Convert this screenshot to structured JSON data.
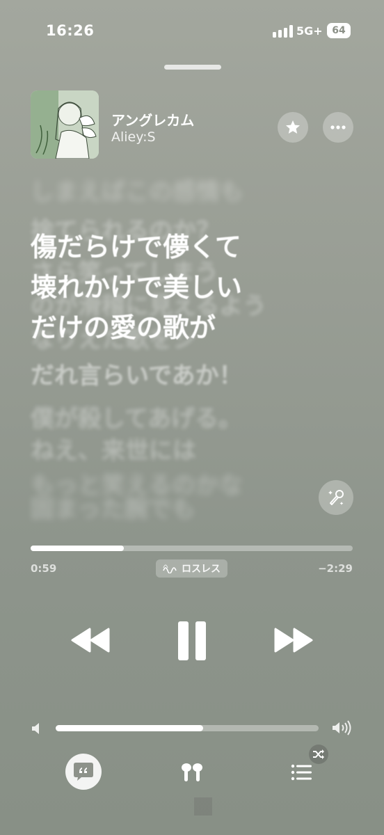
{
  "status_bar": {
    "time": "16:26",
    "network": "5G+",
    "battery": "64"
  },
  "now_playing": {
    "title": "アングレカム",
    "artist": "Aliey:S",
    "favorite_icon": "star-icon",
    "more_icon": "ellipsis-icon"
  },
  "lyrics": {
    "upcoming_top_blurred": [
      "しまえばこの感情も",
      "捨てられるのか？",
      "さら笑ってしまう",
      "のが滑稽に見えるよう",
      "なりえた歌をシ"
    ],
    "active_lines": [
      "傷だらけで儚くて",
      "壊れかけで美しい",
      "だけの愛の歌が"
    ],
    "following_lines": [
      "だれ言らいであか！",
      "僕が殺してあげる。",
      "ねえ、来世には",
      "もっと笑えるのかな",
      "固まった腕でも"
    ],
    "sing_icon": "microphone-sparkle-icon"
  },
  "playback": {
    "progress": 0.29,
    "elapsed": "0:59",
    "remaining": "−2:29",
    "quality_label": "ロスレス",
    "rewind_icon": "rewind-icon",
    "pause_icon": "pause-icon",
    "forward_icon": "fast-forward-icon"
  },
  "volume": {
    "level": 0.56,
    "low_icon": "speaker-low-icon",
    "high_icon": "speaker-high-icon"
  },
  "bottom_bar": {
    "lyrics_icon": "quote-bubble-icon",
    "airplay_icon": "airpods-icon",
    "queue_icon": "list-icon",
    "shuffle_icon": "shuffle-icon"
  },
  "colors": {
    "background": "#989d94",
    "foreground": "#ffffff"
  }
}
